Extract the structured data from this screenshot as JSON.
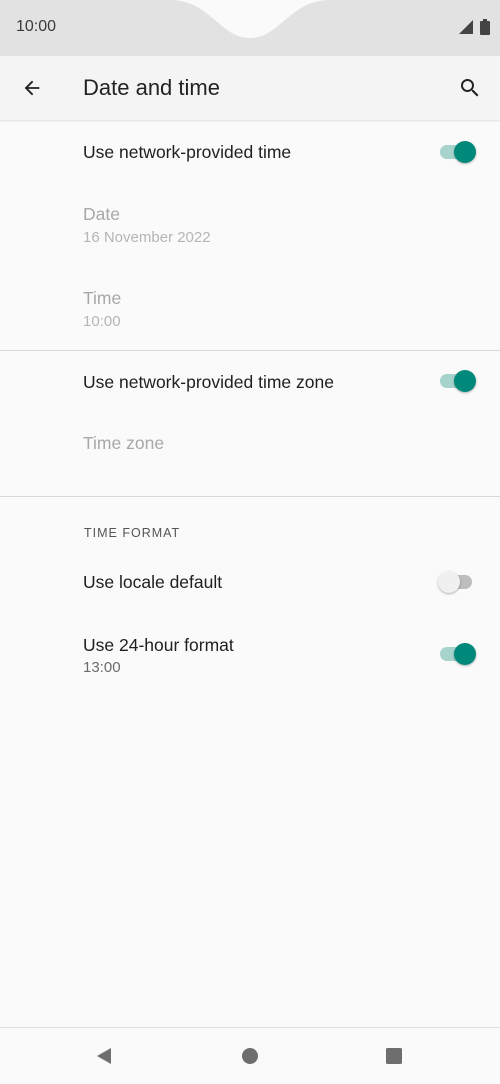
{
  "status_bar": {
    "time": "10:00",
    "icons": [
      "signal-icon",
      "battery-icon"
    ]
  },
  "app_bar": {
    "title": "Date and time",
    "back_icon": "arrow-back-icon",
    "search_icon": "search-icon"
  },
  "settings": {
    "network_time": {
      "title": "Use network-provided time",
      "enabled": true
    },
    "date": {
      "title": "Date",
      "value": "16 November 2022",
      "disabled": true
    },
    "time": {
      "title": "Time",
      "value": "10:00",
      "disabled": true
    },
    "network_time_zone": {
      "title": "Use network-provided time zone",
      "enabled": true
    },
    "time_zone": {
      "title": "Time zone",
      "disabled": true
    },
    "time_format_header": "TIME FORMAT",
    "locale_default": {
      "title": "Use locale default",
      "enabled": false
    },
    "format_24h": {
      "title": "Use 24-hour format",
      "value": "13:00",
      "enabled": true
    }
  },
  "nav_bar": {
    "icons": [
      "back-triangle-icon",
      "home-circle-icon",
      "recents-square-icon"
    ]
  },
  "colors": {
    "accent": "#00897b",
    "accent_track": "#a6d3cc",
    "status_bar_bg": "#e2e2e2",
    "app_bar_bg": "#f4f4f4",
    "page_bg": "#fafafa"
  }
}
